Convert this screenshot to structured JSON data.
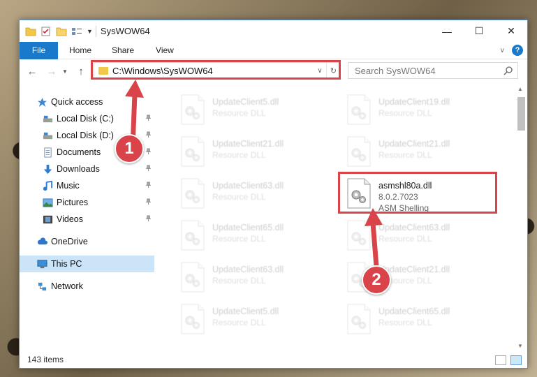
{
  "window": {
    "title": "SysWOW64",
    "controls": [
      "minimize",
      "maximize",
      "close"
    ]
  },
  "ribbon": {
    "file_tab": "File",
    "tabs": [
      "Home",
      "Share",
      "View"
    ]
  },
  "address": {
    "path": "C:\\Windows\\SysWOW64",
    "search_placeholder": "Search SysWOW64"
  },
  "nav": {
    "items": [
      {
        "label": "Quick access",
        "icon": "star-icon",
        "pinned": false
      },
      {
        "label": "Local Disk (C:)",
        "icon": "drive-icon",
        "pinned": true
      },
      {
        "label": "Local Disk (D:)",
        "icon": "drive-icon",
        "pinned": true
      },
      {
        "label": "Documents",
        "icon": "documents-icon",
        "pinned": true
      },
      {
        "label": "Downloads",
        "icon": "download-icon",
        "pinned": true
      },
      {
        "label": "Music",
        "icon": "music-icon",
        "pinned": true
      },
      {
        "label": "Pictures",
        "icon": "pictures-icon",
        "pinned": true
      },
      {
        "label": "Videos",
        "icon": "videos-icon",
        "pinned": true
      },
      {
        "label": "OneDrive",
        "icon": "cloud-icon",
        "pinned": false
      },
      {
        "label": "This PC",
        "icon": "computer-icon",
        "pinned": false,
        "selected": true
      },
      {
        "label": "Network",
        "icon": "network-icon",
        "pinned": false
      }
    ]
  },
  "files": [
    {
      "name": "UpdateClient5.dll",
      "desc": "Resource DLL",
      "faded": true
    },
    {
      "name": "UpdateClient19.dll",
      "desc": "Resource DLL",
      "faded": true
    },
    {
      "name": "UpdateClient21.dll",
      "desc": "Resource DLL",
      "faded": true
    },
    {
      "name": "UpdateClient21.dll",
      "desc": "Resource DLL",
      "faded": true
    },
    {
      "name": "UpdateClient63.dll",
      "desc": "Resource DLL",
      "faded": true
    },
    {
      "name": "asmshl80a.dll",
      "desc": "8.0.2.7023",
      "desc2": "ASM Shelling",
      "faded": false
    },
    {
      "name": "UpdateClient65.dll",
      "desc": "Resource DLL",
      "faded": true
    },
    {
      "name": "UpdateClient63.dll",
      "desc": "Resource DLL",
      "faded": true
    },
    {
      "name": "UpdateClient63.dll",
      "desc": "Resource DLL",
      "faded": true
    },
    {
      "name": "UpdateClient21.dll",
      "desc": "Resource DLL",
      "faded": true
    },
    {
      "name": "UpdateClient5.dll",
      "desc": "Resource DLL",
      "faded": true
    },
    {
      "name": "UpdateClient65.dll",
      "desc": "Resource DLL",
      "faded": true
    }
  ],
  "status": {
    "item_count": "143 items"
  },
  "annotations": {
    "step1": "1",
    "step2": "2",
    "color": "#d9434a"
  }
}
